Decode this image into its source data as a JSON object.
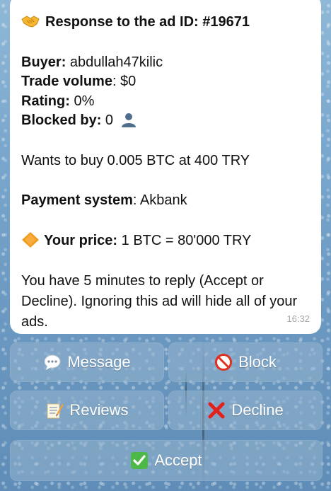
{
  "message": {
    "title": "Response to the ad ID: #19671",
    "buyer_label": "Buyer:",
    "buyer_value": "abdullah47kilic",
    "volume_label": "Trade volume",
    "volume_value": ": $0",
    "rating_label": "Rating:",
    "rating_value": "0%",
    "blocked_label": "Blocked by:",
    "blocked_value": "0",
    "wants": "Wants to buy 0.005 BTC at 400 TRY",
    "payment_label": "Payment system",
    "payment_value": ": Akbank",
    "price_label": "Your price:",
    "price_value": "1 BTC = 80'000 TRY",
    "notice": "You have 5 minutes to reply (Accept or Decline). Ignoring this ad will hide all of your ads.",
    "time": "16:32"
  },
  "buttons": {
    "message": "Message",
    "block": "Block",
    "reviews": "Reviews",
    "decline": "Decline",
    "accept": "Accept"
  },
  "icons": {
    "title": "handshake-icon",
    "blocked": "person-silhouette-icon",
    "price": "orange-diamond-icon",
    "message": "speech-bubble-icon",
    "block": "prohibited-icon",
    "reviews": "memo-icon",
    "decline": "cross-mark-icon",
    "accept": "check-mark-button-icon"
  },
  "colors": {
    "bubble": "#ffffff",
    "text": "#111111",
    "time": "#a6a6a6",
    "button_text": "#ffffff"
  }
}
